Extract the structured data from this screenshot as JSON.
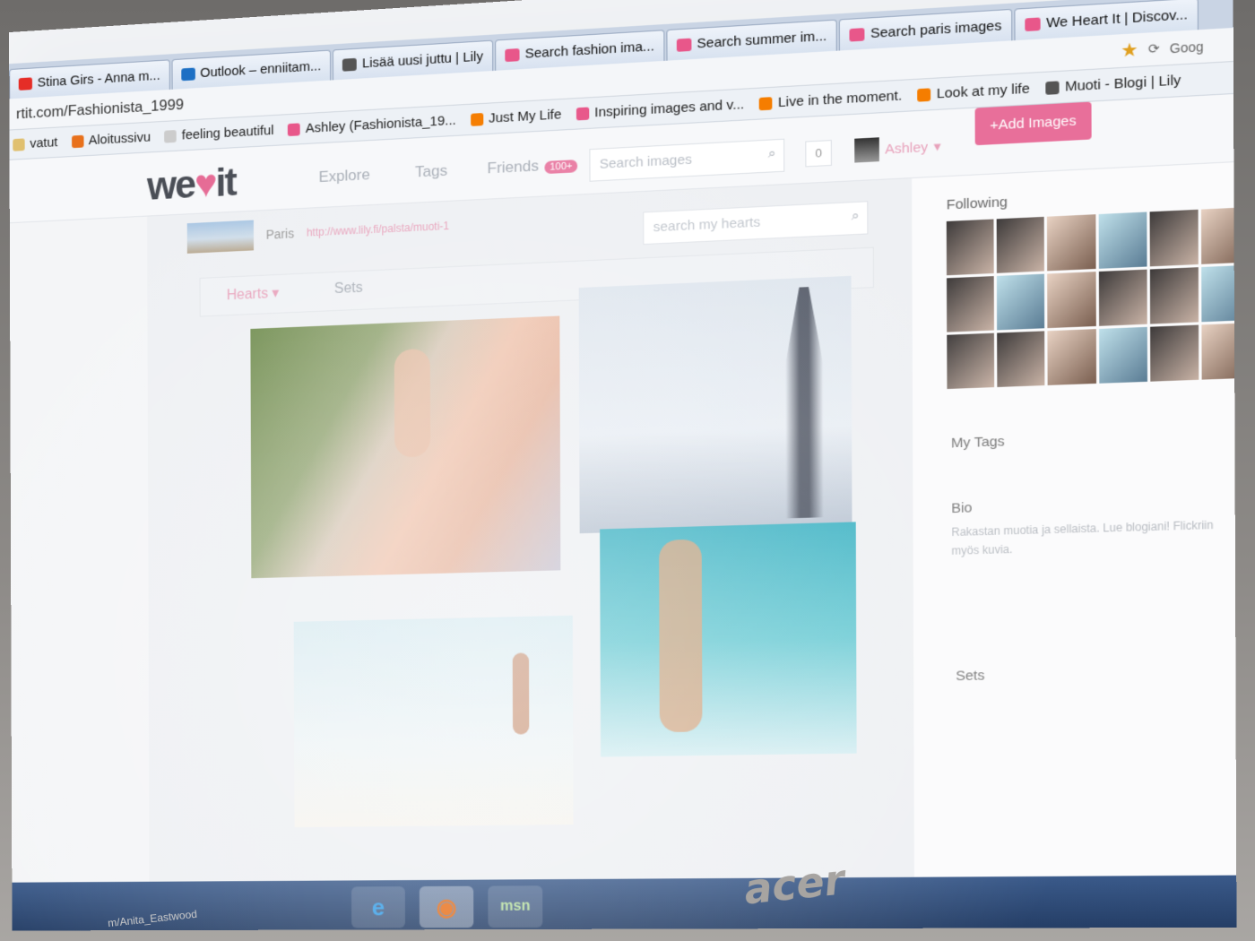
{
  "browser": {
    "tabs": [
      {
        "label": "Stina Girs - Anna m...",
        "icon": "youtube-icon",
        "color": "#e52d27"
      },
      {
        "label": "Outlook – enniitam...",
        "icon": "outlook-icon",
        "color": "#1c6fc4"
      },
      {
        "label": "Lisää uusi juttu | Lily",
        "icon": "lily-icon",
        "color": "#555555"
      },
      {
        "label": "Search fashion ima...",
        "icon": "heart-icon",
        "color": "#e8578a"
      },
      {
        "label": "Search summer im...",
        "icon": "heart-icon",
        "color": "#e8578a"
      },
      {
        "label": "Search paris images",
        "icon": "heart-icon",
        "color": "#e8578a"
      },
      {
        "label": "We Heart It | Discov...",
        "icon": "heart-icon",
        "color": "#e8578a"
      }
    ],
    "url": "rtit.com/Fashionista_1999",
    "search_engine": "Goog",
    "bookmarks": [
      {
        "label": "vatut",
        "icon": "folder-icon",
        "color": "#e0c070"
      },
      {
        "label": "Aloitussivu",
        "icon": "firefox-icon",
        "color": "#e8711c"
      },
      {
        "label": "feeling beautiful",
        "icon": "page-icon",
        "color": "#cccccc"
      },
      {
        "label": "Ashley (Fashionista_19...",
        "icon": "heart-icon",
        "color": "#e8578a"
      },
      {
        "label": "Just My Life",
        "icon": "blogger-icon",
        "color": "#f57d00"
      },
      {
        "label": "Inspiring images and v...",
        "icon": "heart-icon",
        "color": "#e8578a"
      },
      {
        "label": "Live in the moment.",
        "icon": "blogger-icon",
        "color": "#f57d00"
      },
      {
        "label": "Look at my life",
        "icon": "blogger-icon",
        "color": "#f57d00"
      },
      {
        "label": "Muoti - Blogi | Lily",
        "icon": "lily-icon",
        "color": "#555555"
      }
    ]
  },
  "site": {
    "logo": {
      "pre": "we",
      "heart": "♥",
      "post": "it"
    },
    "nav": {
      "explore": "Explore",
      "tags": "Tags",
      "friends": "Friends",
      "friends_badge": "100+"
    },
    "search_placeholder": "Search images",
    "notifications": "0",
    "username": "Ashley",
    "add_images": "+Add Images"
  },
  "profile": {
    "location": "Paris",
    "link": "http://www.lily.fi/palsta/muoti-1",
    "search_hearts_placeholder": "search my hearts",
    "tab_hearts": "Hearts",
    "tab_sets": "Sets"
  },
  "sidebar": {
    "following_title": "Following",
    "my_tags_title": "My Tags",
    "bio_title": "Bio",
    "bio_text": "Rakastan muotia ja sellaista. Lue blogiani! Flickriin myös kuvia.",
    "sets_title": "Sets"
  },
  "taskbar": {
    "ie_label": "e",
    "firefox_label": "◉",
    "msn_label": "msn"
  },
  "laptop_brand": "acer",
  "footer_hint": "m/Anita_Eastwood"
}
